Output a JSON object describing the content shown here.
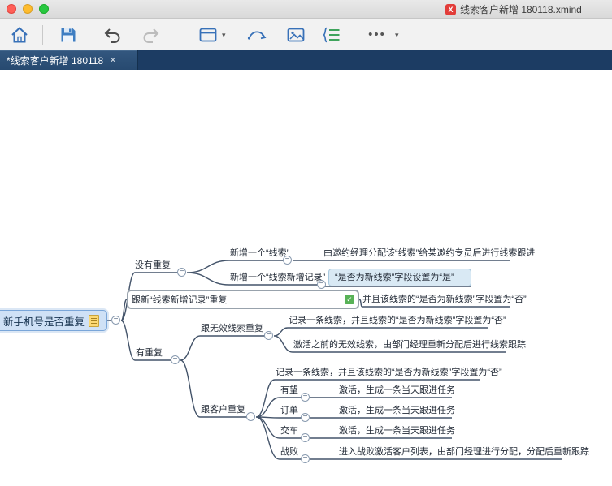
{
  "window": {
    "title": "线索客户新增 180118.xmind"
  },
  "icons": {
    "xmind_file": "X",
    "close_tab": "×",
    "dropdown": "▾",
    "more": "•••",
    "minus": "−",
    "check": "✓"
  },
  "tabbar": {
    "active_tab": "*线索客户新增 180118"
  },
  "toolbar": {
    "items": [
      "home",
      "save",
      "undo",
      "redo",
      "sheet",
      "relationship",
      "insert-image",
      "outline",
      "more"
    ]
  },
  "mindmap": {
    "root": {
      "text": "新手机号是否重复"
    },
    "topics": {
      "no_dup": {
        "text": "没有重复"
      },
      "new_lead": {
        "text": "新增一个“线索”"
      },
      "new_lead_detail": {
        "text": "由邀约经理分配该“线索”给某邀约专员后进行线索跟进"
      },
      "new_record": {
        "text": "新增一个“线索新增记录”"
      },
      "new_record_detail": {
        "text": "“是否为新线索”字段设置为“是”"
      },
      "editing": {
        "text": "跟新“线索新增记录”重复"
      },
      "editing_detail": {
        "text": "并且该线索的“是否为新线索”字段置为“否”"
      },
      "has_dup": {
        "text": "有重复"
      },
      "invalid_dup": {
        "text": "跟无效线索重复"
      },
      "invalid_detail1": {
        "text": "记录一条线索，并且线索的“是否为新线索”字段置为“否”"
      },
      "invalid_detail2": {
        "text": "激活之前的无效线索，由部门经理重新分配后进行线索跟踪"
      },
      "customer_dup": {
        "text": "跟客户重复"
      },
      "customer_detail": {
        "text": "记录一条线索，并且该线索的“是否为新线索”字段置为“否”"
      },
      "hopeful": {
        "text": "有望"
      },
      "hopeful_detail": {
        "text": "激活，生成一条当天跟进任务"
      },
      "order": {
        "text": "订单"
      },
      "order_detail": {
        "text": "激活，生成一条当天跟进任务"
      },
      "delivery": {
        "text": "交车"
      },
      "delivery_detail": {
        "text": "激活，生成一条当天跟进任务"
      },
      "defeat": {
        "text": "战败"
      },
      "defeat_detail": {
        "text": "进入战败激活客户列表，由部门经理进行分配，分配后重新跟踪"
      }
    }
  },
  "colors": {
    "accent": "#3871b8",
    "line": "#44546a",
    "root_fill": "#cfe1f6",
    "root_border": "#7aa6d9",
    "highlight_fill": "#d9e9f4",
    "highlight_border": "#a9c9de",
    "tab_bar": "#1c3c63",
    "check_green": "#58b257"
  }
}
